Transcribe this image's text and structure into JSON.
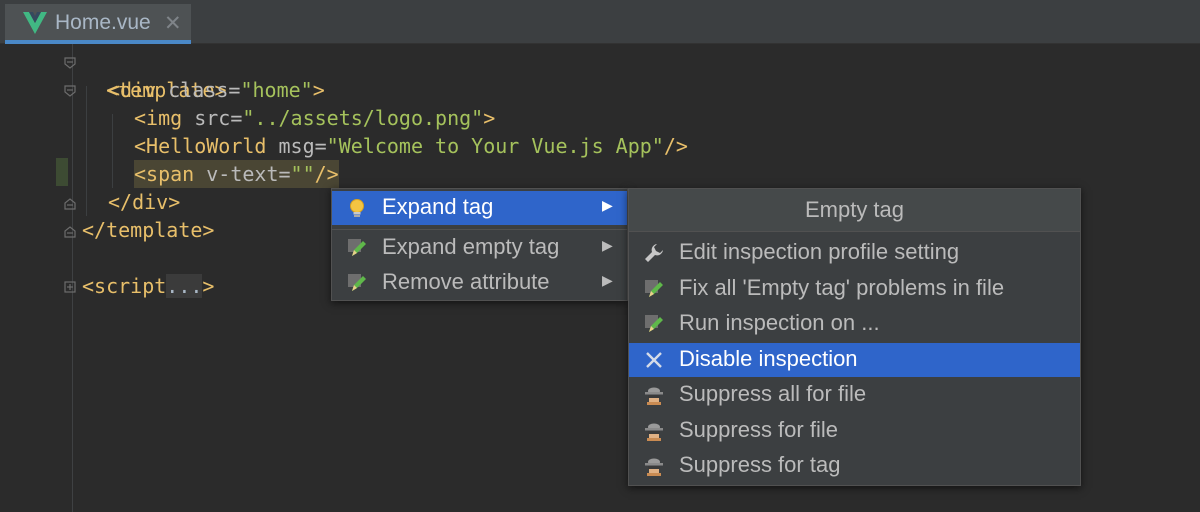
{
  "tab": {
    "title": "Home.vue",
    "close": "✕",
    "icon": "vue-logo-icon"
  },
  "code": {
    "l1_open": "<template>",
    "l2_indent": "  ",
    "l2_tag": "<div ",
    "l2_attr": "class=",
    "l2_val": "\"home\"",
    "l2_end": ">",
    "l3_tag": "<img ",
    "l3_attr": "src=",
    "l3_val": "\"../assets/logo.png\"",
    "l3_end": ">",
    "l4_tag": "<HelloWorld ",
    "l4_attr": "msg=",
    "l4_val": "\"Welcome to Your Vue.js App\"",
    "l4_end": "/>",
    "l5_tag": "<span ",
    "l5_attr": "v-text=",
    "l5_val": "\"\"",
    "l5_end": "/>",
    "l6": "</div>",
    "l7": "</template>",
    "l9_tag": "<script",
    "l9_dots": "...",
    "l9_end": ">"
  },
  "popup": {
    "items": [
      {
        "label": "Expand tag",
        "icon": "lightbulb-icon",
        "arrow": "▶"
      },
      {
        "label": "Expand empty tag",
        "icon": "pencil-icon",
        "arrow": "▶"
      },
      {
        "label": "Remove attribute",
        "icon": "pencil-icon",
        "arrow": "▶"
      }
    ]
  },
  "submenu": {
    "header": "Empty tag",
    "items": [
      {
        "label": "Edit inspection profile setting",
        "icon": "wrench-icon"
      },
      {
        "label": "Fix all 'Empty tag' problems in file",
        "icon": "pencil-icon"
      },
      {
        "label": "Run inspection on ...",
        "icon": "pencil-icon"
      },
      {
        "label": "Disable inspection",
        "icon": "close-icon"
      },
      {
        "label": "Suppress all for file",
        "icon": "spy-icon"
      },
      {
        "label": "Suppress for file",
        "icon": "spy-icon"
      },
      {
        "label": "Suppress for tag",
        "icon": "spy-icon"
      }
    ]
  },
  "colors": {
    "selection": "#2f65ca",
    "tag": "#e8bf6a",
    "string": "#a5c25c"
  }
}
